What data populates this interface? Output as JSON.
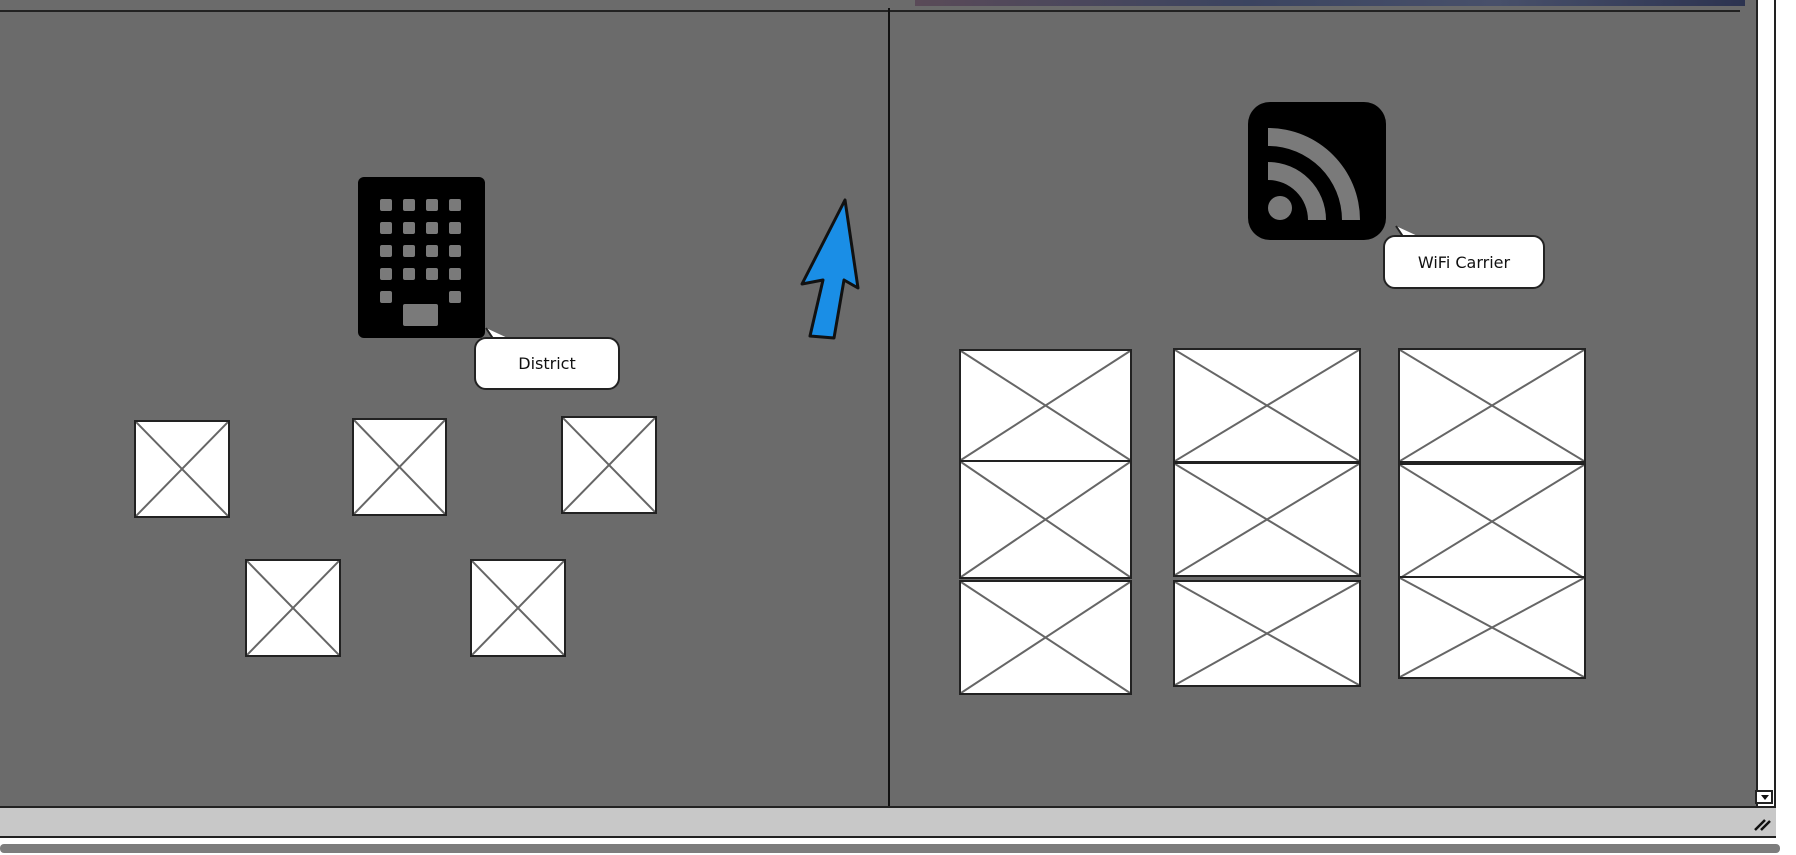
{
  "left_panel": {
    "building_icon": "building-icon",
    "callout_label": "District",
    "arrow_color": "#1a8ee6",
    "placeholders": [
      "image-placeholder",
      "image-placeholder",
      "image-placeholder",
      "image-placeholder",
      "image-placeholder"
    ]
  },
  "right_panel": {
    "feed_icon": "rss-feed-icon",
    "callout_label": "WiFi Carrier",
    "placeholder_grid": {
      "columns": 3,
      "rows": 3
    }
  },
  "colors": {
    "canvas_background": "#6b6b6b",
    "icon_fill": "#000000",
    "arrow": "#1a8ee6"
  }
}
